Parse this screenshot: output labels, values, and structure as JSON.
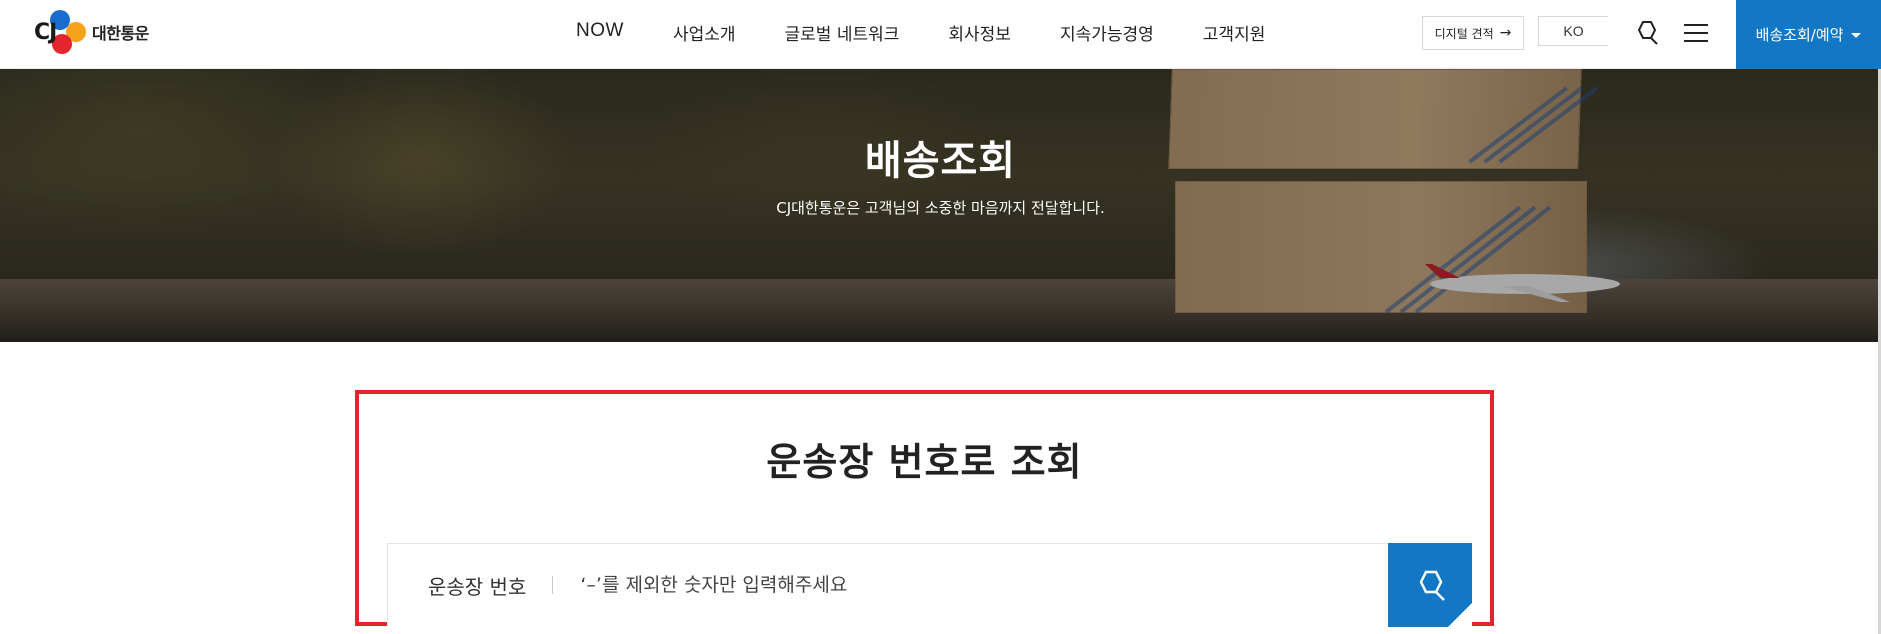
{
  "brand": {
    "logo_cj": "CJ",
    "logo_name": "대한통운"
  },
  "nav": {
    "items": [
      "NOW",
      "사업소개",
      "글로벌 네트워크",
      "회사정보",
      "지속가능경영",
      "고객지원"
    ]
  },
  "utility": {
    "quote_label": "디지털 견적",
    "quote_arrow": "→",
    "lang_label": "KO",
    "delivery_menu_label": "배송조회/예약",
    "search_icon": "search-icon",
    "menu_icon": "hamburger-icon"
  },
  "hero": {
    "title": "배송조회",
    "subtitle": "CJ대한통운은 고객님의 소중한 마음까지 전달합니다."
  },
  "tracking": {
    "title": "운송장 번호로 조회",
    "label": "운송장 번호",
    "placeholder": "‘–’를 제외한 숫자만 입력해주세요",
    "value": ""
  },
  "colors": {
    "brand_blue": "#1278c5",
    "highlight_red": "#e0252d",
    "logo_blue": "#1c6bd1",
    "logo_orange": "#f6a21b",
    "logo_red": "#e3262d"
  }
}
